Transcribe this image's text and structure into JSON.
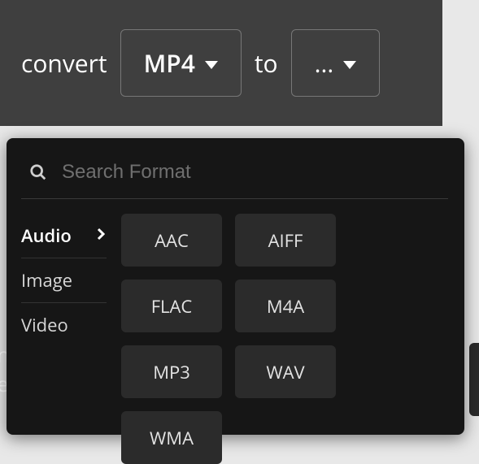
{
  "topbar": {
    "label_convert": "convert",
    "label_to": "to",
    "from_value": "MP4",
    "to_value": "..."
  },
  "dropdown": {
    "search_placeholder": "Search Format",
    "categories": [
      {
        "label": "Audio",
        "active": true
      },
      {
        "label": "Image",
        "active": false
      },
      {
        "label": "Video",
        "active": false
      }
    ],
    "formats": [
      "AAC",
      "AIFF",
      "FLAC",
      "M4A",
      "MP3",
      "WAV",
      "WMA"
    ]
  },
  "background_text": {
    "line1": "n",
    "line2": "e"
  }
}
